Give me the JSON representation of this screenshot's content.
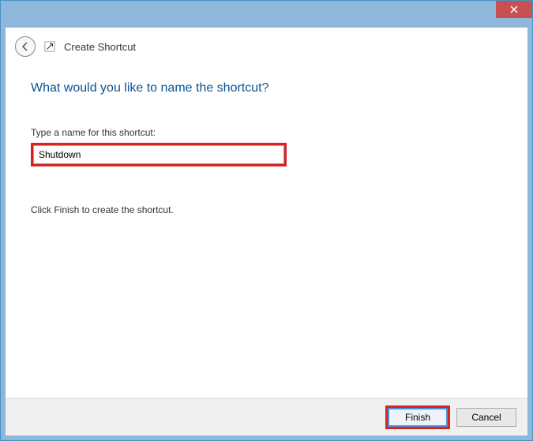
{
  "window": {
    "title": "Create Shortcut"
  },
  "content": {
    "heading": "What would you like to name the shortcut?",
    "field_label": "Type a name for this shortcut:",
    "name_value": "Shutdown",
    "hint": "Click Finish to create the shortcut."
  },
  "buttons": {
    "finish": "Finish",
    "cancel": "Cancel"
  },
  "icons": {
    "close": "close-icon",
    "back": "back-arrow-icon",
    "app": "shortcut-icon"
  }
}
